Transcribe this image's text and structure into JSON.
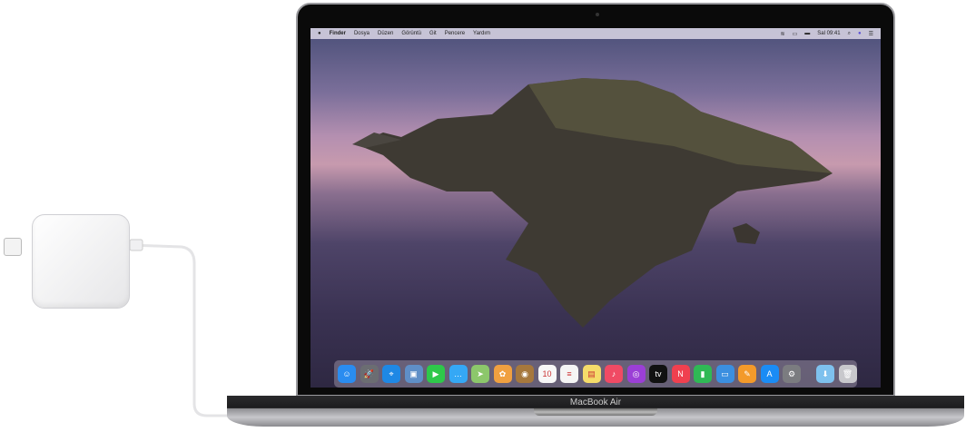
{
  "menubar": {
    "apple": "",
    "items": [
      "Finder",
      "Dosya",
      "Düzen",
      "Görüntü",
      "Git",
      "Pencere",
      "Yardım"
    ],
    "clock": "Sal 09:41",
    "status_icons": [
      "wifi-icon",
      "airplay-icon",
      "battery-icon",
      "search-icon",
      "siri-icon",
      "notification-center-icon"
    ]
  },
  "dock": {
    "apps": [
      {
        "name": "finder",
        "glyph": "☺",
        "color": "#2a8cf0"
      },
      {
        "name": "launchpad",
        "glyph": "🚀",
        "color": "#6b6d72"
      },
      {
        "name": "safari",
        "glyph": "⌖",
        "color": "#1e88e5"
      },
      {
        "name": "preview",
        "glyph": "▣",
        "color": "#5f8fc7"
      },
      {
        "name": "facetime",
        "glyph": "▶",
        "color": "#2ec84a"
      },
      {
        "name": "messages",
        "glyph": "…",
        "color": "#35a8f5"
      },
      {
        "name": "maps",
        "glyph": "➤",
        "color": "#8cc76b"
      },
      {
        "name": "photos",
        "glyph": "✿",
        "color": "#f0a040"
      },
      {
        "name": "contacts",
        "glyph": "◉",
        "color": "#a6783d"
      },
      {
        "name": "calendar",
        "glyph": "10",
        "color": "#f7f7f7"
      },
      {
        "name": "reminders",
        "glyph": "≡",
        "color": "#f5f5f5"
      },
      {
        "name": "notes",
        "glyph": "▤",
        "color": "#f5dc6a"
      },
      {
        "name": "music",
        "glyph": "♪",
        "color": "#f04a64"
      },
      {
        "name": "podcasts",
        "glyph": "◎",
        "color": "#9b3fd6"
      },
      {
        "name": "tv",
        "glyph": "tv",
        "color": "#111111"
      },
      {
        "name": "news",
        "glyph": "N",
        "color": "#f0404f"
      },
      {
        "name": "numbers",
        "glyph": "▮",
        "color": "#2fb955"
      },
      {
        "name": "keynote",
        "glyph": "▭",
        "color": "#3b8fe0"
      },
      {
        "name": "pages",
        "glyph": "✎",
        "color": "#f39a2a"
      },
      {
        "name": "app-store",
        "glyph": "A",
        "color": "#1a8cf5"
      },
      {
        "name": "system-preferences",
        "glyph": "⚙",
        "color": "#7b7c80"
      }
    ],
    "extras": [
      {
        "name": "downloads",
        "glyph": "⬇",
        "color": "#7ec1ee"
      },
      {
        "name": "trash",
        "glyph": "🗑",
        "color": "#c8c8cc"
      }
    ]
  },
  "laptop": {
    "model": "MacBook Air"
  }
}
